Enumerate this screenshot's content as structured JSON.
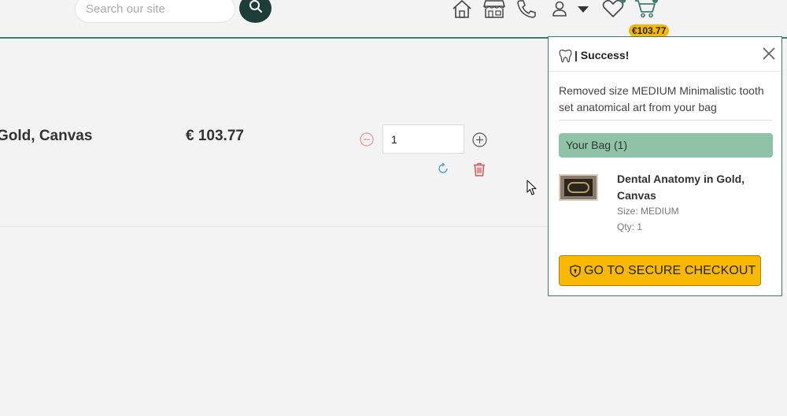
{
  "header": {
    "search_placeholder": "Search our site",
    "cart_total": "€103.77",
    "icons": [
      "search-icon",
      "home-icon",
      "store-icon",
      "phone-icon",
      "user-icon",
      "caret-down-icon",
      "heart-icon",
      "cart-icon"
    ]
  },
  "cart_row": {
    "product_name": "Gold, Canvas",
    "price": "€ 103.77",
    "quantity": "1"
  },
  "popup": {
    "title": "| Success!",
    "message": "Removed size MEDIUM Minimalistic tooth set anatomical art from your bag",
    "bag_label": "Your Bag (1)",
    "item": {
      "name": "Dental Anatomy in Gold, Canvas",
      "size": "Size: MEDIUM",
      "qty": "Qty: 1"
    },
    "checkout_label": "GO TO SECURE CHECKOUT"
  },
  "colors": {
    "accent": "#3d7c70",
    "search_button": "#1d3d39",
    "bag_bar": "#8ec3a7",
    "checkout": "#f8b900",
    "remove": "#d9534f",
    "refresh": "#4aa3d8"
  }
}
